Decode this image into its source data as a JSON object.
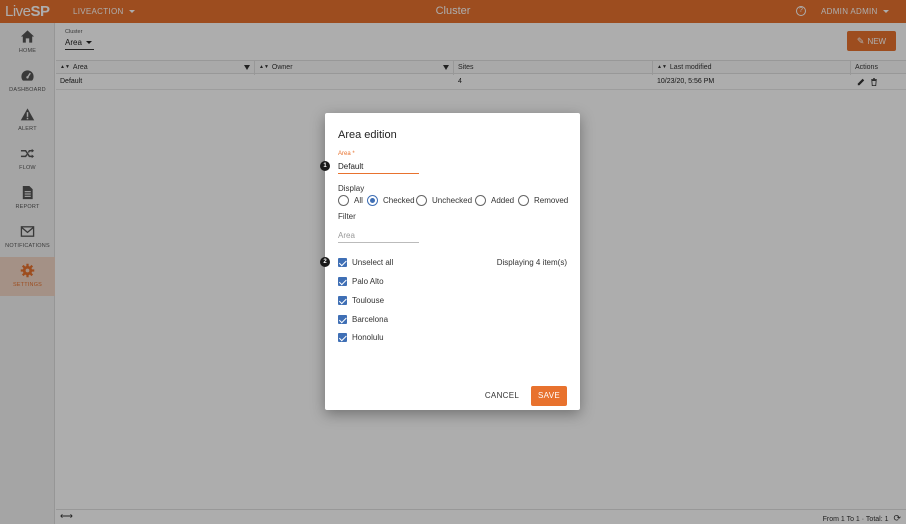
{
  "app": {
    "logo_prefix": "Live",
    "logo_suffix": "SP",
    "tenant_menu": "LIVEACTION",
    "page_title": "Cluster",
    "help_icon_text": "?",
    "user_menu": "ADMIN ADMIN"
  },
  "sidebar": {
    "items": [
      {
        "label": "HOME",
        "icon": "home-icon"
      },
      {
        "label": "DASHBOARD",
        "icon": "gauge-icon"
      },
      {
        "label": "ALERT",
        "icon": "warning-icon"
      },
      {
        "label": "FLOW",
        "icon": "flow-arrows-icon"
      },
      {
        "label": "REPORT",
        "icon": "document-icon"
      },
      {
        "label": "NOTIFICATIONS",
        "icon": "envelope-icon"
      },
      {
        "label": "SETTINGS",
        "icon": "gear-icon",
        "active": true
      }
    ]
  },
  "toolbar": {
    "breadcrumb_label": "Cluster",
    "breadcrumb_value": "Area",
    "new_label": "NEW"
  },
  "table": {
    "headers": [
      "Area",
      "Owner",
      "Sites",
      "Last modified",
      "Actions"
    ],
    "rows": [
      {
        "area": "Default",
        "owner": "",
        "sites": "4",
        "last_modified": "10/23/20, 5:56 PM"
      }
    ]
  },
  "footer": {
    "pagination": "From 1 To 1 · Total: 1"
  },
  "dialog": {
    "title": "Area edition",
    "area_label": "Area *",
    "area_value": "Default",
    "display_label": "Display",
    "display_options": [
      "All",
      "Checked",
      "Unchecked",
      "Added",
      "Removed"
    ],
    "display_selected": "Checked",
    "filter_label": "Filter",
    "filter_placeholder": "Area",
    "unselect_all_label": "Unselect all",
    "displaying_count": "Displaying 4 item(s)",
    "sites": [
      {
        "name": "Palo Alto",
        "checked": true
      },
      {
        "name": "Toulouse",
        "checked": true
      },
      {
        "name": "Barcelona",
        "checked": true
      },
      {
        "name": "Honolulu",
        "checked": true
      }
    ],
    "cancel_label": "CANCEL",
    "save_label": "SAVE"
  },
  "callouts": [
    "1",
    "2"
  ],
  "colors": {
    "brand": "#e8722e",
    "checkbox": "#3f6fb5",
    "overlay": "rgba(0,0,0,0.32)"
  }
}
